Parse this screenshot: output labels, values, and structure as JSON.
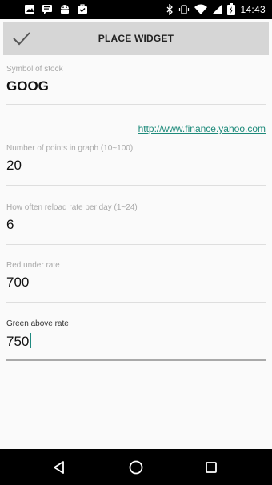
{
  "status_bar": {
    "time": "14:43",
    "left_icons": [
      "image-icon",
      "message-icon",
      "android-icon",
      "briefcase-icon"
    ],
    "right_icons": [
      "bluetooth-icon",
      "vibrate-icon",
      "wifi-icon",
      "signal-icon",
      "battery-icon"
    ]
  },
  "action_bar": {
    "title": "PLACE WIDGET",
    "confirm_icon": "check-icon"
  },
  "form": {
    "symbol": {
      "label": "Symbol of stock",
      "value": "GOOG"
    },
    "link": {
      "text": "http://www.finance.yahoo.com"
    },
    "points": {
      "label": "Number of points in graph (10~100)",
      "value": "20"
    },
    "reload": {
      "label": "How often reload rate per day (1~24)",
      "value": "6"
    },
    "red": {
      "label": "Red under rate",
      "value": "700"
    },
    "green": {
      "label": "Green above rate",
      "value": "750"
    }
  },
  "nav_bar": {
    "icons": [
      "back-icon",
      "home-icon",
      "recents-icon"
    ]
  },
  "colors": {
    "accent": "#1d8a7a",
    "action_bar": "#d6d6d6",
    "background": "#fafafa"
  }
}
